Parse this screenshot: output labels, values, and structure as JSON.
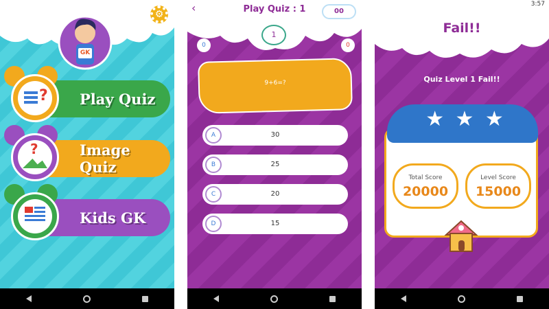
{
  "home": {
    "avatar_badge": "GK",
    "menu": [
      {
        "label": "Play Quiz",
        "icon": "question-list-icon"
      },
      {
        "label": "Image Quiz",
        "icon": "image-question-icon"
      },
      {
        "label": "Kids GK",
        "icon": "newspaper-icon"
      }
    ]
  },
  "quiz": {
    "title": "Play Quiz : 1",
    "timer": "00",
    "question_number": "1",
    "correct_count": "0",
    "wrong_count": "0",
    "question": "9+6=?",
    "answers": [
      {
        "letter": "A",
        "value": "30"
      },
      {
        "letter": "B",
        "value": "25"
      },
      {
        "letter": "C",
        "value": "20"
      },
      {
        "letter": "D",
        "value": "15"
      }
    ]
  },
  "result": {
    "status_time": "3:57",
    "title": "Fail!!",
    "message": "Quiz Level 1 Fail!!",
    "total_score_label": "Total Score",
    "total_score": "20000",
    "level_score_label": "Level Score",
    "level_score": "15000",
    "stars": 3
  },
  "colors": {
    "teal": "#3fc7d6",
    "purple": "#8e2c96",
    "orange": "#f2a91d",
    "green": "#3aa74a",
    "violet": "#9a4fbf"
  }
}
